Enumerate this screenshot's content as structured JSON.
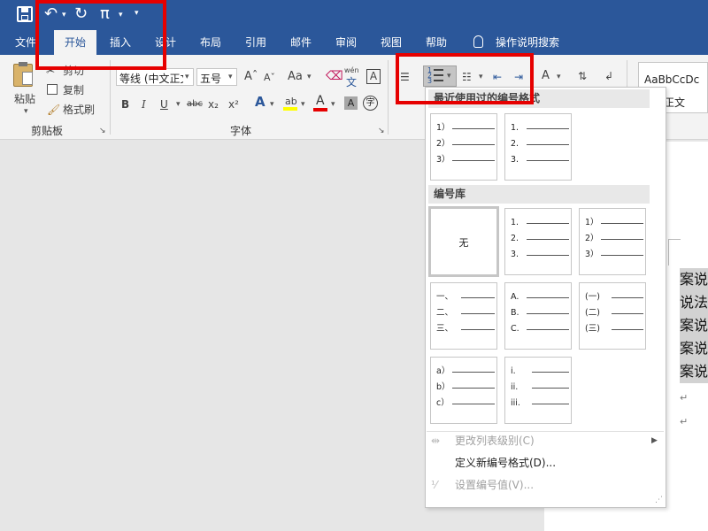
{
  "qat": {
    "save_icon": "save-icon",
    "undo_icon": "undo-icon",
    "redo_icon": "redo-icon",
    "equation_symbol": "π",
    "customize_icon": "customize-qat-icon"
  },
  "tabs": [
    {
      "label": "文件"
    },
    {
      "label": "开始"
    },
    {
      "label": "插入"
    },
    {
      "label": "设计"
    },
    {
      "label": "布局"
    },
    {
      "label": "引用"
    },
    {
      "label": "邮件"
    },
    {
      "label": "审阅"
    },
    {
      "label": "视图"
    },
    {
      "label": "帮助"
    }
  ],
  "tell_me": {
    "label": "操作说明搜索",
    "icon": "lightbulb-icon"
  },
  "clipboard": {
    "paste_label": "粘贴",
    "cut_label": "剪切",
    "copy_label": "复制",
    "format_painter_label": "格式刷",
    "group_label": "剪贴板"
  },
  "font": {
    "font_name": "等线 (中文正文)",
    "font_size": "五号",
    "grow_icon": "Aˆ",
    "shrink_icon": "Aˇ",
    "change_case": "Aa",
    "bold": "B",
    "italic": "I",
    "underline": "U",
    "strikethrough": "abc",
    "subscript": "x₂",
    "superscript": "x²",
    "text_effects": "A",
    "highlight_icon": "highlighter-icon",
    "font_color": "A",
    "char_shading": "A",
    "enclose_char": "字",
    "phonetic_top": "wén",
    "phonetic_bottom": "文",
    "group_label": "字体"
  },
  "styles": {
    "preview": "AaBbCcDc",
    "name": "正文"
  },
  "colors": {
    "title_bar": "#2b579a",
    "ribbon": "#f3f3f3",
    "annotation": "#e60000",
    "font_color_bar": "#e60000",
    "highlight_bar": "#ffff00"
  },
  "numbering_menu": {
    "recent_header": "最近使用过的编号格式",
    "recent": [
      {
        "markers": [
          "1）",
          "2）",
          "3）"
        ]
      },
      {
        "markers": [
          "1.",
          "2.",
          "3."
        ]
      }
    ],
    "library_header": "编号库",
    "library_none": "无",
    "library": [
      {
        "markers": [
          "1.",
          "2.",
          "3."
        ]
      },
      {
        "markers": [
          "1）",
          "2）",
          "3）"
        ]
      },
      {
        "markers": [
          "一、",
          "二、",
          "三、"
        ]
      },
      {
        "markers": [
          "A.",
          "B.",
          "C."
        ]
      },
      {
        "markers": [
          "(一)",
          "(二)",
          "(三)"
        ]
      },
      {
        "markers": [
          "a）",
          "b）",
          "c）"
        ]
      },
      {
        "markers": [
          "i.",
          "ii.",
          "iii."
        ]
      }
    ],
    "change_level": "更改列表级别(C)",
    "define_new": "定义新编号格式(D)...",
    "set_value": "设置编号值(V)..."
  },
  "document": {
    "lines": [
      "案说",
      "说法",
      "案说",
      "案说",
      "案说"
    ],
    "para_mark": "↵"
  }
}
